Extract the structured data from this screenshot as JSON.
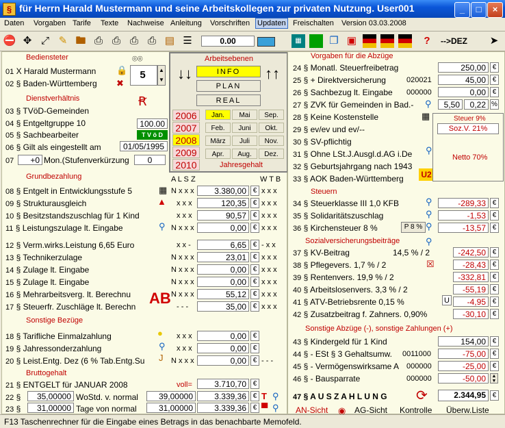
{
  "window": {
    "title": "für Herrn Harald Mustermann und seine Arbeitskollegen zur privaten Nutzung.     User001",
    "minimize": "_",
    "maximize": "□",
    "close": "×"
  },
  "menu": [
    "Daten",
    "Vorgaben",
    "Tarife",
    "Texte",
    "Nachweise",
    "Anleitung",
    "Vorschriften",
    "Updaten",
    "Freischalten",
    "Version 03.03.2008"
  ],
  "toolbar": {
    "amount": "0.00",
    "dez": "-->DEZ"
  },
  "bediensteter": {
    "header": "Bediensteter",
    "r01": {
      "no": "01",
      "text": "X Harald Mustermann"
    },
    "r02": {
      "no": "02",
      "text": "§ Baden-Württemberg"
    },
    "spin": "5"
  },
  "arbeitsebenen": {
    "header": "Arbeitsebenen",
    "modes": [
      "INFO",
      "PLAN",
      "REAL"
    ],
    "years": [
      "2006",
      "2007",
      "2008",
      "2009",
      "2010"
    ],
    "months": [
      "Jan.",
      "Mai",
      "Sep.",
      "Feb.",
      "Juni",
      "Okt.",
      "März",
      "Juli",
      "Nov.",
      "Apr.",
      "Aug.",
      "Dez."
    ],
    "jahresgehalt": "Jahresgehalt"
  },
  "dienst": {
    "header": "Dienstverhältnis",
    "r03": {
      "no": "03",
      "text": "§ TVöD-Gemeinden"
    },
    "r04": {
      "no": "04",
      "text": "§ Entgeltgruppe 10",
      "val": "100.00"
    },
    "r05": {
      "no": "05",
      "text": "§ Sachbearbeiter",
      "badge": "T V ö D"
    },
    "r06": {
      "no": "06",
      "text": "§ Gilt als eingestellt am",
      "val": "01/05/1995"
    },
    "r07": {
      "no": "07",
      "text": "Mon.(Stufenverkürzung",
      "pre": "+0",
      "val": "0"
    }
  },
  "grund": {
    "header": "Grundbezahlung",
    "cols": "A L S Z",
    "cols2": "W T B",
    "rows": [
      {
        "no": "08",
        "text": "§ Entgelt in Entwicklungsstufe 5",
        "flags": "N x x x",
        "val": "3.380,00",
        "flags2": "x x x"
      },
      {
        "no": "09",
        "text": "§ Strukturausgleich",
        "flags": "x x x",
        "val": "120,35",
        "flags2": "x x x"
      },
      {
        "no": "10",
        "text": "§ Besitzstandszuschlag für 1 Kind",
        "flags": "x x x",
        "val": "90,57",
        "flags2": "x x x"
      },
      {
        "no": "11",
        "text": "§ Leistungszulage lt. Eingabe",
        "flags": "N x x x",
        "val": "0,00",
        "flags2": "x x x"
      },
      {
        "no": "12",
        "text": "§ Verm.wirks.Leistung   6,65 Euro",
        "flags": "x x -",
        "val": "6,65",
        "flags2": "- x x"
      },
      {
        "no": "13",
        "text": "§ Technikerzulage",
        "flags": "N x x x",
        "val": "23,01",
        "flags2": "x x x"
      },
      {
        "no": "14",
        "text": "§ Zulage lt. Eingabe",
        "flags": "N x x x",
        "val": "0,00",
        "flags2": "x x x"
      },
      {
        "no": "15",
        "text": "§ Zulage lt. Eingabe",
        "flags": "N x x x",
        "val": "0,00",
        "flags2": "x x x"
      },
      {
        "no": "16",
        "text": "§ Mehrarbeitsverg. lt. Berechnu",
        "flags": "N x x x",
        "val": "55,12",
        "flags2": "x x x"
      },
      {
        "no": "17",
        "text": "§ Steuerfr. Zuschläge lt. Berechn",
        "flags": "- - -",
        "val": "35,00",
        "flags2": "x x x"
      }
    ]
  },
  "sonstige": {
    "header": "Sonstige Bezüge",
    "rows": [
      {
        "no": "18",
        "text": "§ Tarifliche Einmalzahlung",
        "flags": "x x x",
        "val": "0,00"
      },
      {
        "no": "19",
        "text": "§ Jahressonderzahlung",
        "flags": "x x x",
        "val": "0,00"
      },
      {
        "no": "20",
        "text": "§ Leist.Entg. Dez (6 % Tab.Entg.Su",
        "flags": "N x x x",
        "val": "0,00",
        "flags2": "- - -"
      }
    ]
  },
  "brutto": {
    "header": "Bruttogehalt",
    "r21": {
      "no": "21",
      "text": "§ ENTGELT für JANUAR  2008",
      "label": "voll=",
      "val": "3.710,70"
    },
    "r22": {
      "no": "22",
      "pre": "§",
      "h": "35,00000",
      "text": "WoStd. v. normal",
      "v1": "39,00000",
      "val": "3.339,36"
    },
    "r23": {
      "no": "23",
      "pre": "§",
      "h": "31,00000",
      "text": "Tage von normal",
      "v1": "31,00000",
      "val": "3.339,36"
    }
  },
  "vorgaben": {
    "header": "Vorgaben für die Abzüge",
    "rows": [
      {
        "no": "24",
        "text": "§ Monatl. Steuerfreibetrag",
        "val": "250,00"
      },
      {
        "no": "25",
        "text": "§ + Direktversicherung",
        "code": "020021",
        "val": "45,00"
      },
      {
        "no": "26",
        "text": "§ Sachbezug lt. Eingabe",
        "code": "000000",
        "val": "0,00"
      },
      {
        "no": "27",
        "text": "§ ZVK für Gemeinden in Bad.-",
        "v1": "5,50",
        "v2": "0,22",
        "unit": "%"
      },
      {
        "no": "28",
        "text": "§ Keine Kostenstelle"
      },
      {
        "no": "29",
        "text": "§ ev/ev und ev/--"
      },
      {
        "no": "30",
        "text": "§ SV-pflichtig"
      },
      {
        "no": "31",
        "text": "§ Ohne LSt.J.Ausgl.d.AG i.De"
      },
      {
        "no": "32",
        "text": "§ Geburtsjahrgang nach 1943"
      },
      {
        "no": "33",
        "text": "§ AOK Baden-Württemberg",
        "badge": "U2"
      }
    ],
    "box": {
      "steuer": "Steuer 9%",
      "sozv": "Soz.V. 21%",
      "netto": "Netto   70%"
    }
  },
  "steuern": {
    "header": "Steuern",
    "rows": [
      {
        "no": "34",
        "text": "§ Steuerklasse III    1,0 KFB",
        "val": "-289,33"
      },
      {
        "no": "35",
        "text": "§ Solidaritätszuschlag",
        "val": "-1,53"
      },
      {
        "no": "36",
        "text": "§ Kirchensteuer 8 %",
        "tag": "P 8 %",
        "val": "-13,57"
      }
    ]
  },
  "sv": {
    "header": "Sozialversicherungsbeiträge",
    "rows": [
      {
        "no": "37",
        "text": "§ KV-Beitrag",
        "rate": "14,5 % / 2",
        "val": "-242,50"
      },
      {
        "no": "38",
        "text": "§ Pflegevers. 1,7 % / 2",
        "val": "-28,43"
      },
      {
        "no": "39",
        "text": "§ Rentenvers.  19,9 % / 2",
        "val": "-332,81"
      },
      {
        "no": "40",
        "text": "§ Arbeitslosenvers.  3,3 % / 2",
        "val": "-55,19"
      },
      {
        "no": "41",
        "text": "§ ATV-Betriebsrente 0,15 %",
        "tag": "U",
        "val": "-4,95"
      },
      {
        "no": "42",
        "text": "§ Zusatzbeitrag f. Zahners. 0,90%",
        "val": "-30,10"
      }
    ]
  },
  "sonstabz": {
    "header": "Sonstige Abzüge (-), sonstige Zahlungen (+)",
    "rows": [
      {
        "no": "43",
        "text": "§ Kindergeld für 1 Kind",
        "val": "154,00"
      },
      {
        "no": "44",
        "text": "§  - ESt § 3 Gehaltsumw.",
        "code": "0011000",
        "val": "-75,00"
      },
      {
        "no": "45",
        "text": "§  - Vermögenswirksame A",
        "code": "000000",
        "val": "-25,00"
      },
      {
        "no": "46",
        "text": "§  - Bausparrate",
        "code": "000000",
        "val": "-50,00"
      }
    ]
  },
  "auszahlung": {
    "no": "47",
    "text": "§ A U S Z A H L U N G",
    "val": "2.344,95"
  },
  "views": [
    "AN-Sicht",
    "AG-Sicht",
    "Kontrolle",
    "Überw.Liste"
  ],
  "euro": "€",
  "status": "F13 Taschenrechner für die Eingabe eines Betrags in das benachbarte Memofeld.",
  "colors": {
    "accent_red": "#c00000",
    "highlight": "#ffff00",
    "panel": "#fbfbe6"
  }
}
